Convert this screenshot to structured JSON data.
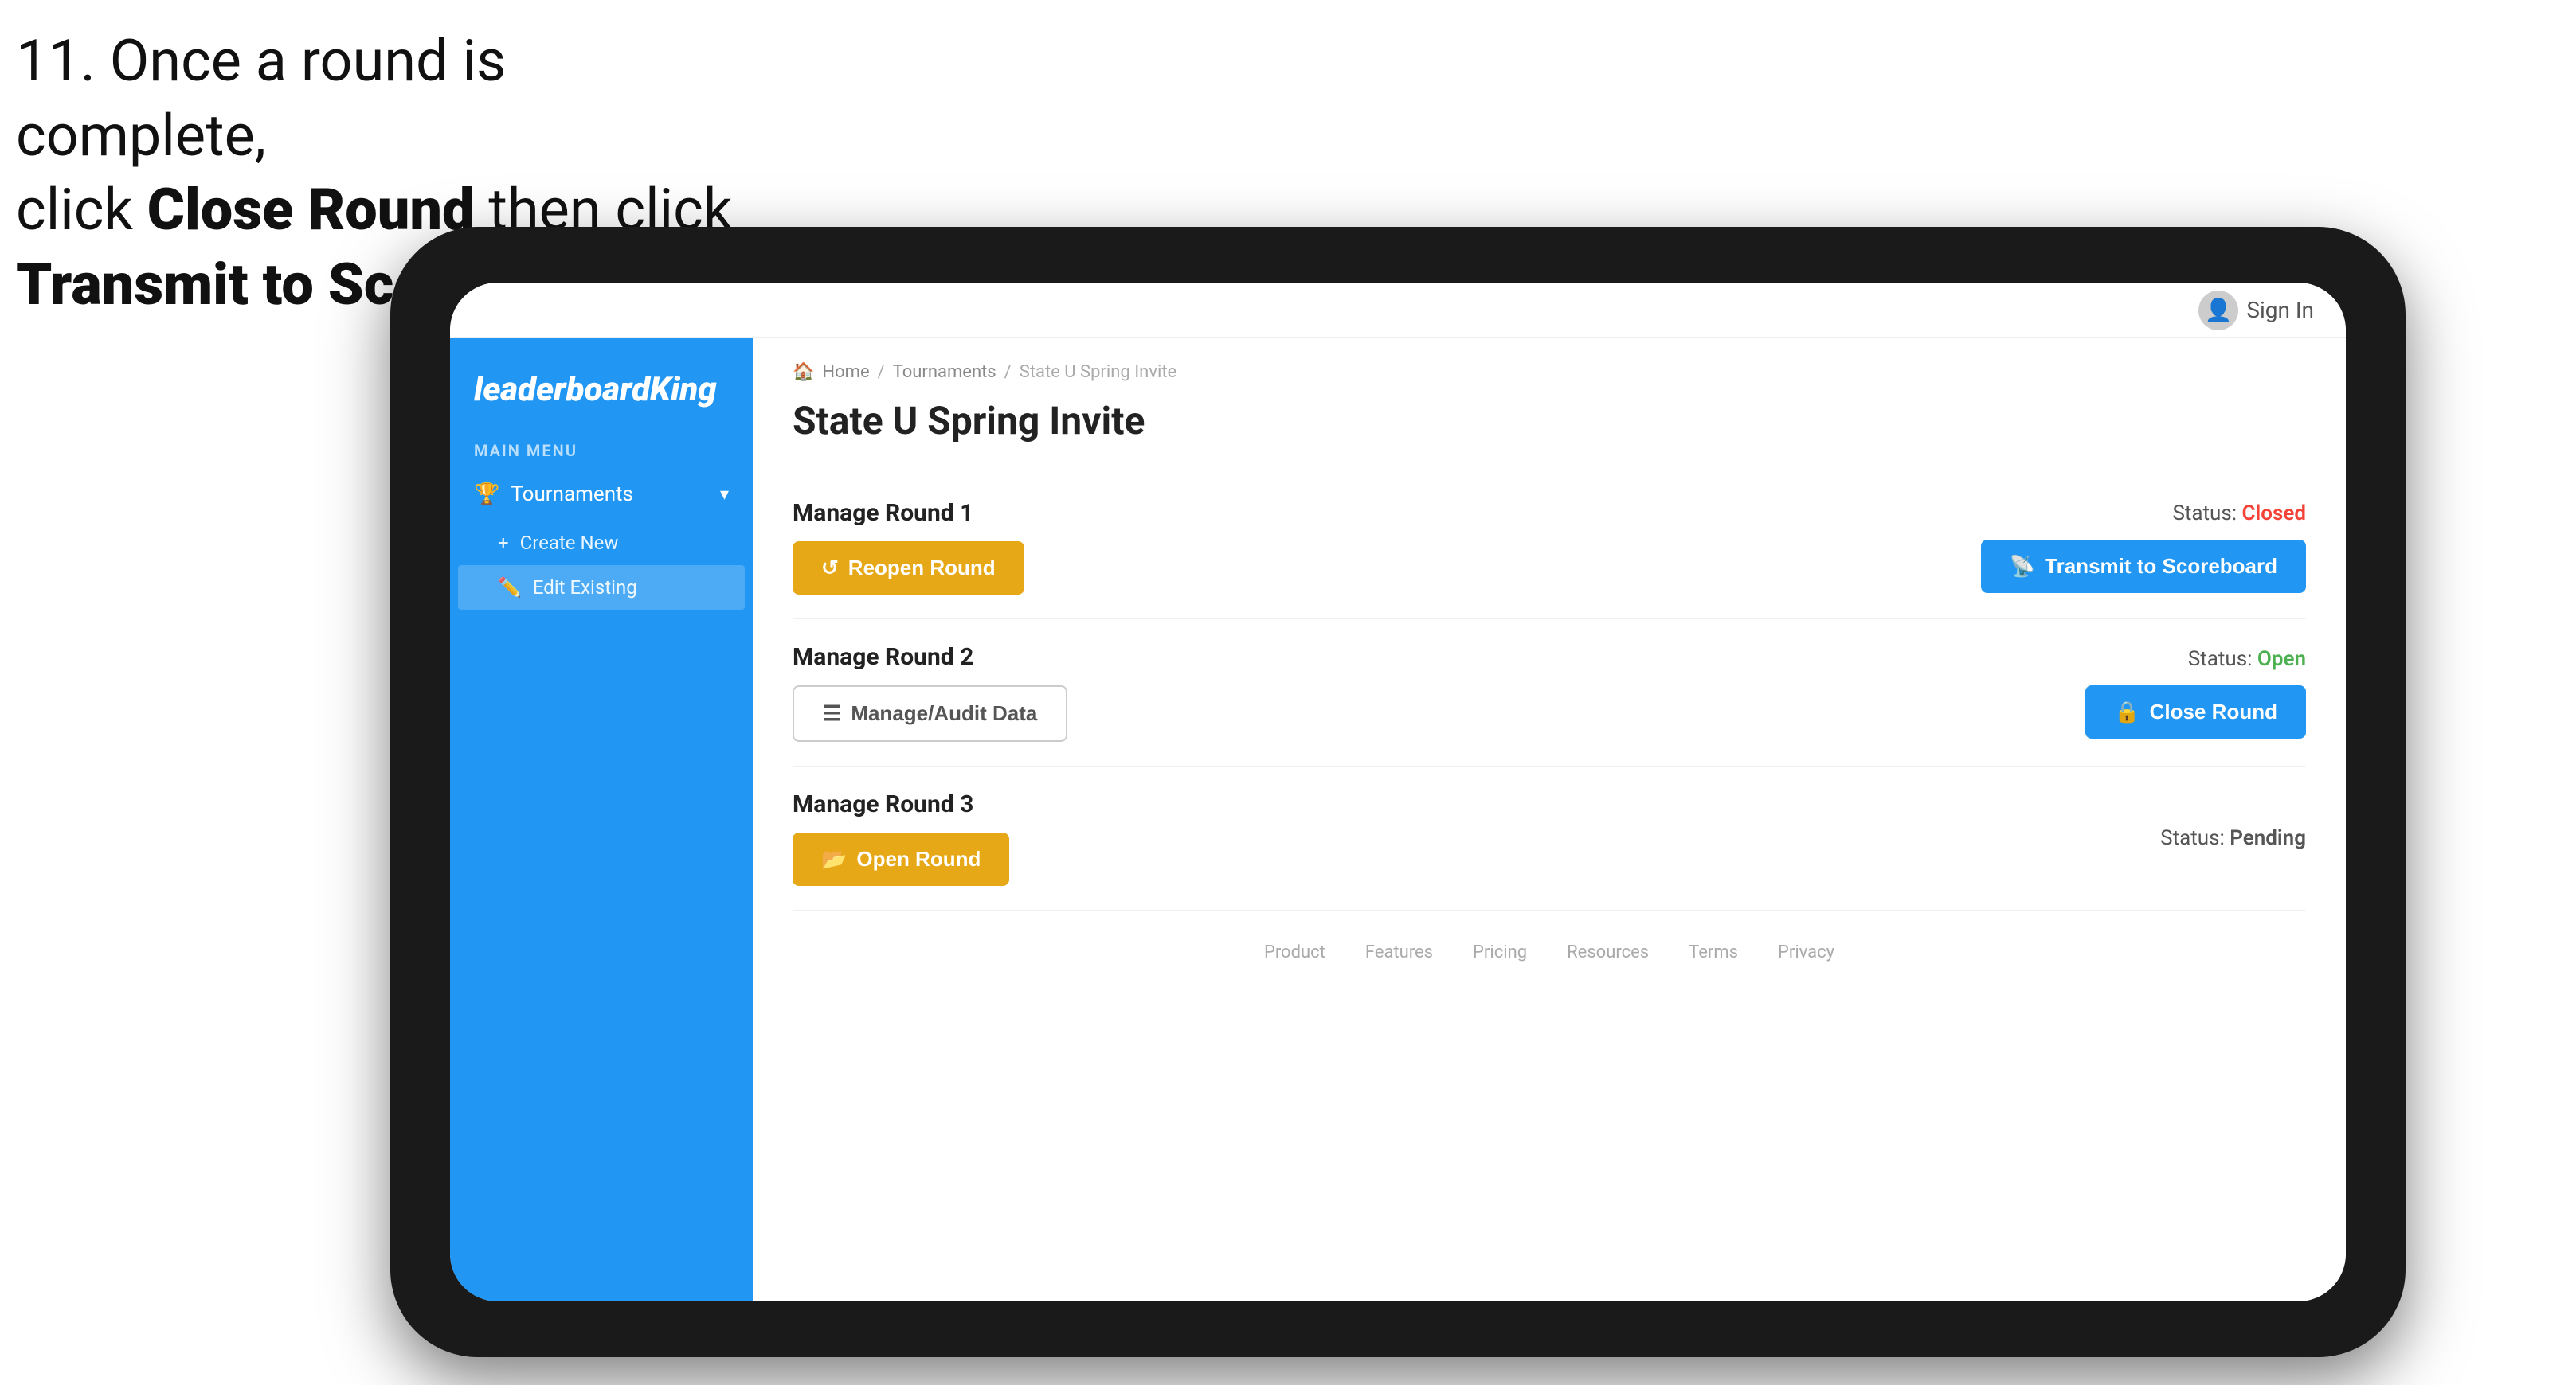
{
  "instruction": {
    "line1": "11. Once a round is complete,",
    "line2_normal": "click ",
    "line2_bold": "Close Round",
    "line2_end": " then click",
    "line3_bold": "Transmit to Scoreboard."
  },
  "tablet": {
    "header": {
      "sign_in_label": "Sign In"
    },
    "sidebar": {
      "logo": "leaderboard",
      "logo_bold": "King",
      "main_menu_label": "MAIN MENU",
      "tournaments_label": "Tournaments",
      "create_new_label": "Create New",
      "edit_existing_label": "Edit Existing"
    },
    "content": {
      "breadcrumb": {
        "home": "Home",
        "separator1": "/",
        "tournaments": "Tournaments",
        "separator2": "/",
        "current": "State U Spring Invite"
      },
      "page_title": "State U Spring Invite",
      "rounds": [
        {
          "id": 1,
          "title": "Manage Round 1",
          "status_label": "Status:",
          "status_value": "Closed",
          "status_type": "closed",
          "primary_button_label": "Reopen Round",
          "primary_button_type": "gold",
          "secondary_button_label": "Transmit to Scoreboard",
          "secondary_button_type": "blue"
        },
        {
          "id": 2,
          "title": "Manage Round 2",
          "status_label": "Status:",
          "status_value": "Open",
          "status_type": "open",
          "primary_button_label": "Manage/Audit Data",
          "primary_button_type": "outline",
          "secondary_button_label": "Close Round",
          "secondary_button_type": "blue"
        },
        {
          "id": 3,
          "title": "Manage Round 3",
          "status_label": "Status:",
          "status_value": "Pending",
          "status_type": "pending",
          "primary_button_label": "Open Round",
          "primary_button_type": "gold",
          "secondary_button_label": null,
          "secondary_button_type": null
        }
      ],
      "footer_links": [
        "Product",
        "Features",
        "Pricing",
        "Resources",
        "Terms",
        "Privacy"
      ]
    }
  }
}
